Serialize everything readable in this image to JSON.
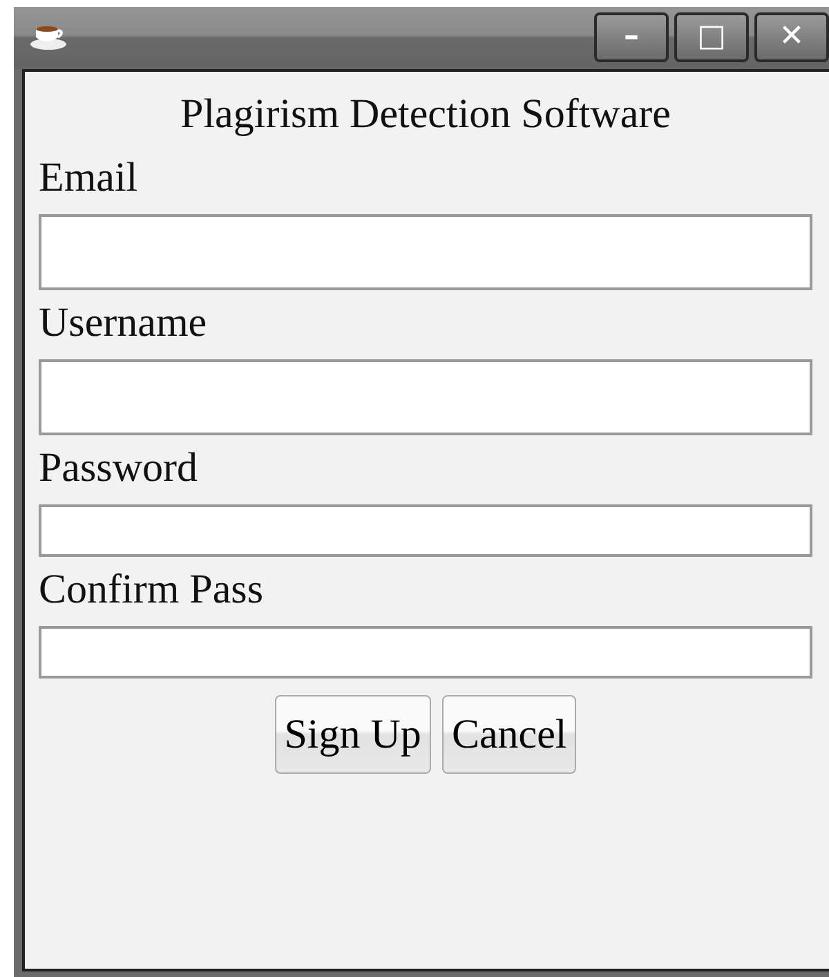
{
  "window": {
    "title_buttons": [
      "–",
      "□",
      "✕"
    ]
  },
  "heading": "Plagirism Detection Software",
  "fields": [
    {
      "label": "Email",
      "kind": "tall"
    },
    {
      "label": "Username",
      "kind": "tall"
    },
    {
      "label": "Password",
      "kind": "short"
    },
    {
      "label": "Confirm Pass",
      "kind": "short"
    }
  ],
  "buttons": [
    "Sign Up",
    "Cancel"
  ]
}
